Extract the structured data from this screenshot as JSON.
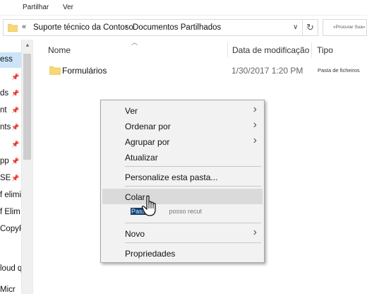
{
  "ribbon": {
    "tabs": [
      "Partilhar",
      "Ver"
    ]
  },
  "address": {
    "overflow": "«",
    "crumbs": [
      "Suporte técnico da Contoso",
      "Documentos Partilhados"
    ],
    "separator": "›",
    "dropdown": "∨",
    "refresh": "↻"
  },
  "search": {
    "placeholder": "«Procurar Sua»"
  },
  "nav": {
    "items": [
      {
        "label": "ess",
        "pinned": false
      },
      {
        "label": "",
        "pinned": true
      },
      {
        "label": "ds",
        "pinned": true
      },
      {
        "label": "nt",
        "pinned": true
      },
      {
        "label": "nts",
        "pinned": true
      },
      {
        "label": "",
        "pinned": true
      },
      {
        "label": "pp",
        "pinned": true
      },
      {
        "label": "SE",
        "pinned": true
      },
      {
        "label": "f eliminar",
        "pinned": false
      },
      {
        "label": "f Elim",
        "pinned": false
      },
      {
        "label": "CopyF",
        "pinned": false
      },
      {
        "label": "",
        "pinned": false
      },
      {
        "label": "loud que",
        "pinned": false
      },
      {
        "label": "Micr",
        "pinned": false
      }
    ]
  },
  "columns": {
    "name": "Nome",
    "modified": "Data de modificação",
    "type": "Tipo"
  },
  "files": [
    {
      "name": "Formulários",
      "modified": "1/30/2017 1:20 PM",
      "type": "Pasta de ficheiros"
    }
  ],
  "context_menu": {
    "items": [
      {
        "label": "Ver",
        "submenu": true
      },
      {
        "label": "Ordenar por",
        "submenu": true
      },
      {
        "label": "Agrupar por",
        "submenu": true
      },
      {
        "label": "Atualizar",
        "submenu": false
      },
      {
        "label": "Personalize esta pasta...",
        "submenu": false
      },
      {
        "label": "Colar",
        "submenu": false,
        "highlighted": true
      },
      {
        "label": "Novo",
        "submenu": true
      },
      {
        "label": "Propriedades",
        "submenu": false
      }
    ],
    "arrow": "›"
  },
  "status_overlay": {
    "highlighted": "Pass",
    "rest": "posso recut"
  },
  "colors": {
    "selection": "#cce4f7",
    "menu_bg": "#f2f2f2",
    "menu_highlight": "#dadada",
    "folder": "#f8d775"
  },
  "icons": {
    "folder": "folder-icon",
    "pin": "pin-icon",
    "cursor": "hand-pointer-icon"
  }
}
